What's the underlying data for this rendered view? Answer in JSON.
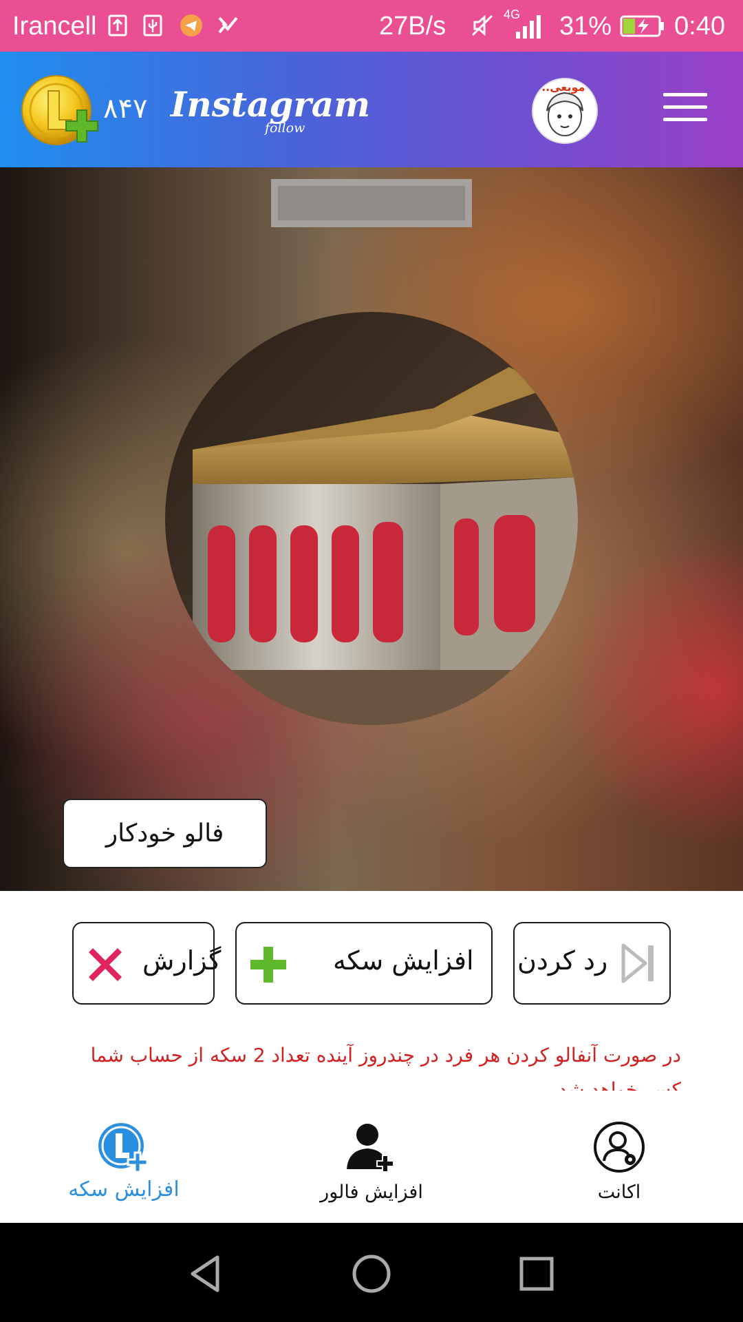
{
  "status_bar": {
    "carrier": "Irancell",
    "network_speed": "27B/s",
    "network_type": "4G",
    "battery_percent": "31%",
    "time": "0:40",
    "icons": [
      "upload-icon",
      "usb-icon",
      "telegram-icon",
      "check-icon",
      "mute-icon",
      "signal-icon",
      "battery-charging-icon"
    ]
  },
  "header": {
    "coin_count": "۸۴۷",
    "brand_title": "Instagram",
    "brand_subtitle": "follow",
    "avatar_caption": "موبعی..."
  },
  "profile": {
    "auto_follow_label": "فالو خودکار"
  },
  "actions": {
    "report_label": "گزارش",
    "add_coin_label": "افزایش سکه",
    "skip_label": "رد کردن"
  },
  "notice": {
    "text": "در صورت آنفالو کردن هر فرد در چندروز آینده تعداد 2 سکه از حساب شما کسر خواهد شد",
    "color": "#d02020"
  },
  "bottom_nav": {
    "items": [
      {
        "label": "افزایش سکه",
        "icon": "coin-plus-icon",
        "active": true
      },
      {
        "label": "افزایش فالور",
        "icon": "add-user-icon",
        "active": false
      },
      {
        "label": "اکانت",
        "icon": "account-settings-icon",
        "active": false
      }
    ]
  },
  "colors": {
    "status_bar": "#ea4f93",
    "header_start": "#1f8ff0",
    "header_end": "#9b40c6",
    "active_nav": "#2b8fe0"
  }
}
